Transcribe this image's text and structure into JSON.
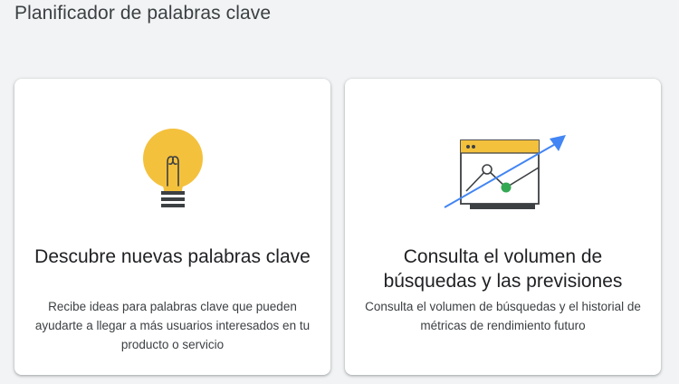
{
  "header": {
    "title": "Planificador de palabras clave"
  },
  "cards": [
    {
      "icon": "lightbulb-icon",
      "title": "Descubre nuevas palabras clave",
      "description": "Recibe ideas para palabras clave que pueden ayudarte a llegar a más usuarios interesados en tu producto o servicio"
    },
    {
      "icon": "trend-chart-icon",
      "title": "Consulta el volumen de búsquedas y las previsiones",
      "description": "Consulta el volumen de búsquedas y el historial de métricas de rendimiento futuro"
    }
  ],
  "colors": {
    "background": "#f1f3f4",
    "bulb": "#f4c13d",
    "chart_header": "#f4c13d",
    "arrow": "#4285f4",
    "point_green": "#34a853"
  }
}
